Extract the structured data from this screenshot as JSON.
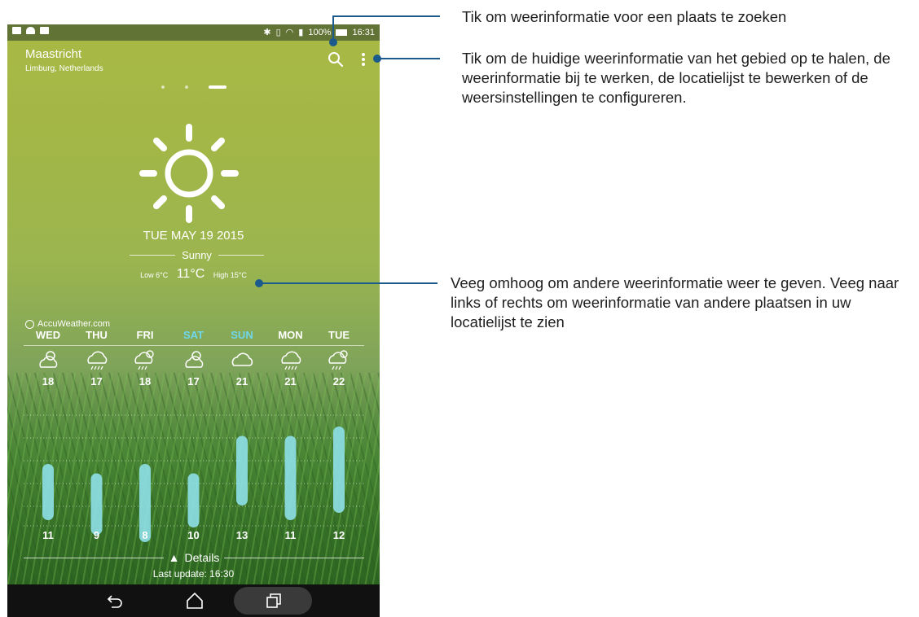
{
  "status_bar": {
    "battery_text": "100%",
    "time": "16:31"
  },
  "location": {
    "city": "Maastricht",
    "region": "Limburg, Netherlands"
  },
  "current": {
    "date": "TUE MAY 19 2015",
    "condition": "Sunny",
    "low": "Low 6°C",
    "temp": "11°C",
    "high": "High 15°C"
  },
  "provider": "AccuWeather.com",
  "forecast": [
    {
      "day": "WED",
      "icon": "partly-sunny-icon",
      "high": "18",
      "low": "11",
      "weekend": false
    },
    {
      "day": "THU",
      "icon": "rain-icon",
      "high": "17",
      "low": "9",
      "weekend": false
    },
    {
      "day": "FRI",
      "icon": "sun-rain-icon",
      "high": "18",
      "low": "8",
      "weekend": false
    },
    {
      "day": "SAT",
      "icon": "partly-sunny-icon",
      "high": "17",
      "low": "10",
      "weekend": true
    },
    {
      "day": "SUN",
      "icon": "cloud-icon",
      "high": "21",
      "low": "13",
      "weekend": true
    },
    {
      "day": "MON",
      "icon": "rain-icon",
      "high": "21",
      "low": "11",
      "weekend": false
    },
    {
      "day": "TUE",
      "icon": "sun-rain-icon",
      "high": "22",
      "low": "12",
      "weekend": false
    }
  ],
  "footer": {
    "details": "Details",
    "last_update": "Last update: 16:30"
  },
  "callouts": {
    "search": "Tik om weerinformatie voor een plaats te zoeken",
    "menu": "Tik om de huidige weerinformatie van het gebied op te halen, de weerinformatie bij te werken, de locatielijst te bewerken of de weersinstellingen te configureren.",
    "swipe": "Veeg omhoog om andere weerinformatie weer te geven. Veeg naar links of rechts om weerinformatie van andere plaatsen in uw locatielijst te zien"
  },
  "colors": {
    "weekend_day": "#6fd7ec",
    "bar_fill": "#8ee0e8",
    "callout_line": "#1b5a8c"
  }
}
